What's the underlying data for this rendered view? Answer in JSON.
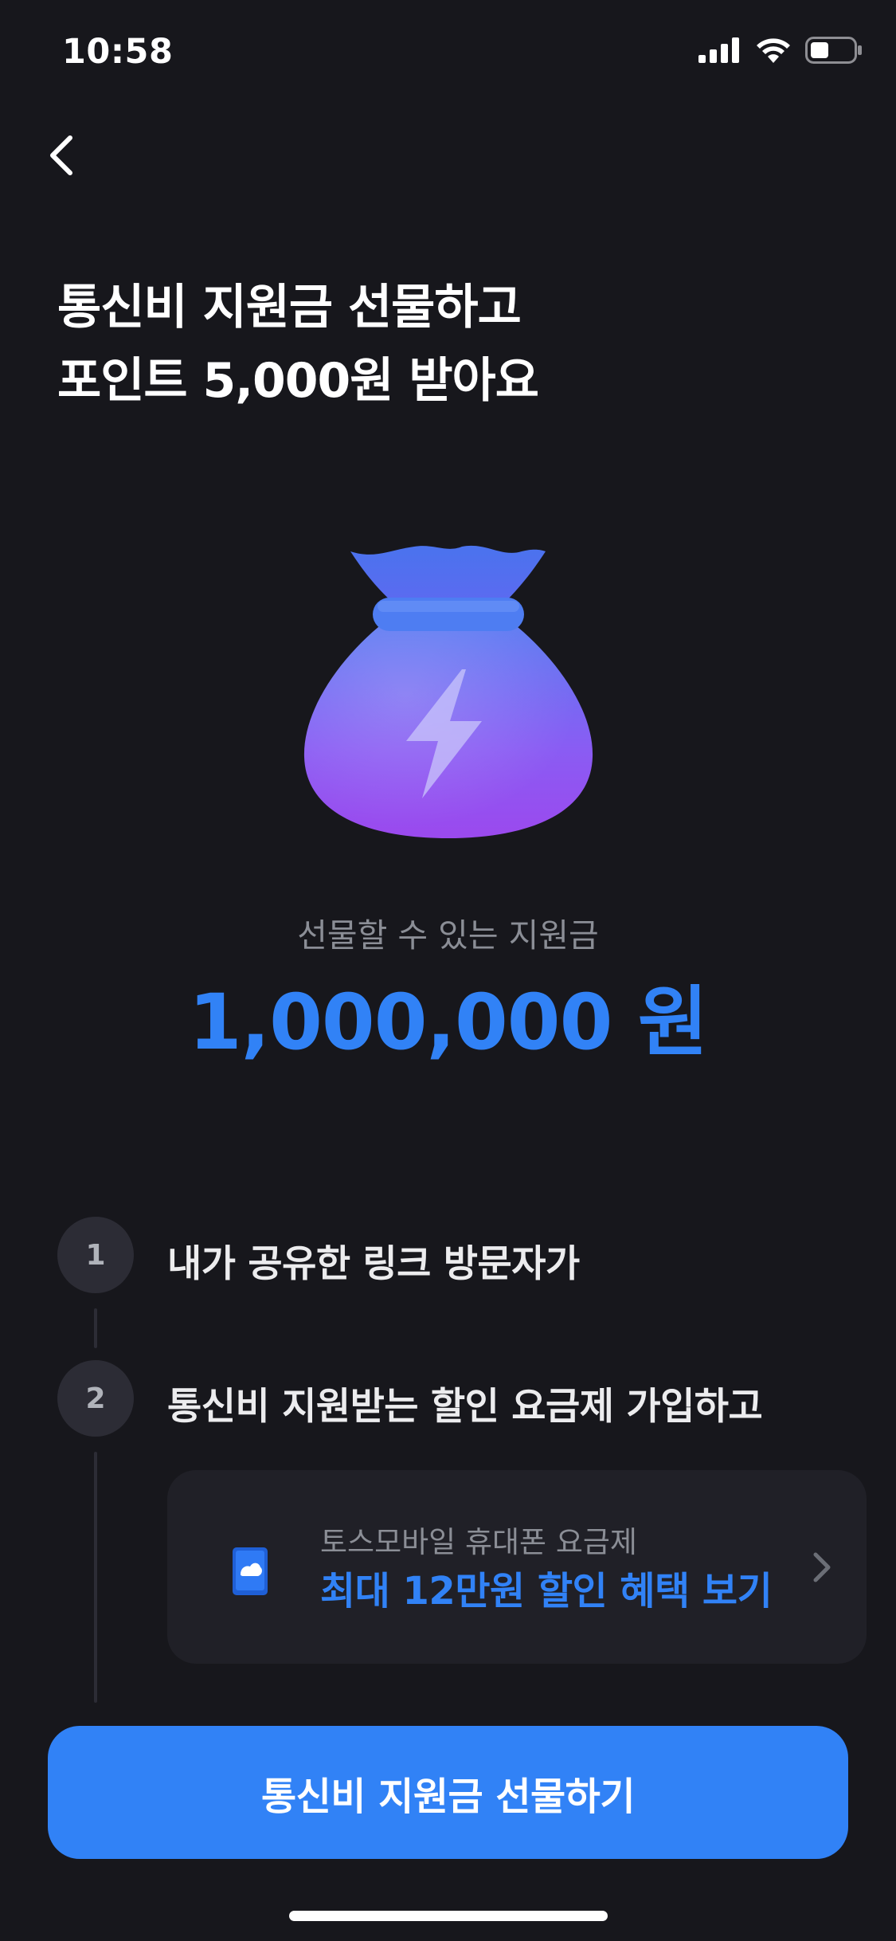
{
  "status_bar": {
    "time": "10:58"
  },
  "header": {
    "headline_line1": "통신비 지원금 선물하고",
    "headline_line2": "포인트 5,000원 받아요"
  },
  "amount": {
    "label": "선물할 수 있는 지원금",
    "value": "1,000,000 원"
  },
  "steps": [
    {
      "number": "1",
      "text": "내가 공유한 링크 방문자가"
    },
    {
      "number": "2",
      "text": "통신비 지원받는 할인 요금제 가입하고"
    }
  ],
  "plan_card": {
    "title": "토스모바일 휴대폰 요금제",
    "subtitle": "최대 12만원 할인 혜택 보기"
  },
  "cta": {
    "label": "통신비 지원금 선물하기"
  },
  "icons": {
    "back": "chevron-left-icon",
    "card_chevron": "chevron-right-icon",
    "illustration": "money-bag-lightning"
  },
  "colors": {
    "accent": "#3182f6",
    "background": "#17171c",
    "card": "#202027"
  }
}
